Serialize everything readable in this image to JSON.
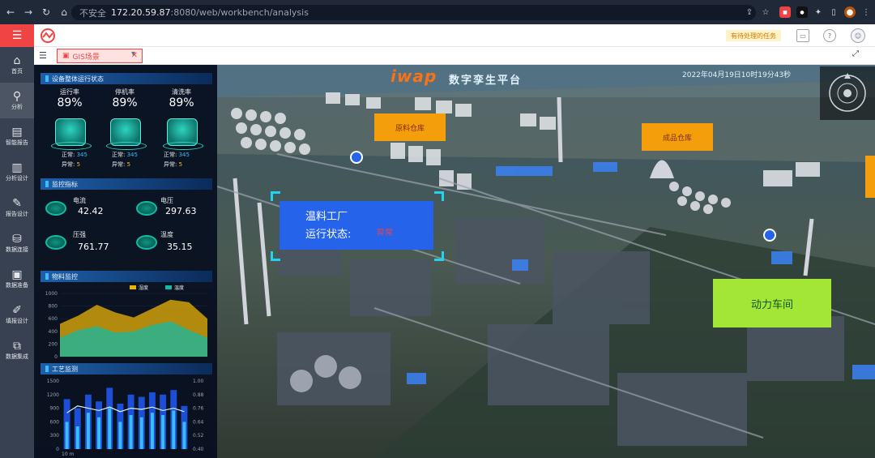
{
  "browser": {
    "security": "不安全",
    "host": "172.20.59.87",
    "path": ":8080/web/workbench/analysis"
  },
  "app": {
    "hint": "有待处理的任务",
    "tabs": [
      {
        "label": "GIS场景"
      }
    ]
  },
  "sidebar": {
    "items": [
      {
        "label": "首页",
        "icon": "home-icon"
      },
      {
        "label": "分析",
        "icon": "analysis-icon"
      },
      {
        "label": "智能报告",
        "icon": "report-icon"
      },
      {
        "label": "分析设计",
        "icon": "design-icon"
      },
      {
        "label": "报告设计",
        "icon": "report-design-icon"
      },
      {
        "label": "数据连接",
        "icon": "data-connect-icon"
      },
      {
        "label": "数据准备",
        "icon": "data-prep-icon"
      },
      {
        "label": "填报设计",
        "icon": "form-icon"
      },
      {
        "label": "数据集成",
        "icon": "integrate-icon"
      }
    ]
  },
  "dashboard": {
    "brand": "iwap",
    "title": "数字孪生平台",
    "datetime": "2022年04月19日10时19分43秒",
    "device_section": "设备整体运行状态",
    "kpis": [
      {
        "label": "运行率",
        "value": "89%",
        "normal": "345",
        "abnormal": "5"
      },
      {
        "label": "停机率",
        "value": "89%",
        "normal": "345",
        "abnormal": "5"
      },
      {
        "label": "清洗率",
        "value": "89%",
        "normal": "345",
        "abnormal": "5"
      }
    ],
    "normal_label": "正常:",
    "abnormal_label": "异常:",
    "monitor_section": "监控指标",
    "monitors": [
      {
        "label": "电流",
        "value": "42.42"
      },
      {
        "label": "电压",
        "value": "297.63"
      },
      {
        "label": "压强",
        "value": "761.77"
      },
      {
        "label": "温度",
        "value": "35.15"
      }
    ],
    "material_section": "物料监控",
    "material_legend": [
      "湿度",
      "温度"
    ],
    "material_yticks": [
      "1000",
      "800",
      "600",
      "400",
      "200",
      "0"
    ],
    "process_section": "工艺监测",
    "process_left_ticks": [
      "1500",
      "1200",
      "900",
      "600",
      "300",
      "0"
    ],
    "process_right_ticks": [
      "1.00",
      "0.88",
      "0.76",
      "0.64",
      "0.52",
      "0.40"
    ],
    "process_xlabel": "10 m"
  },
  "chart_data": [
    {
      "type": "area",
      "ylim": [
        0,
        1000
      ],
      "series": [
        {
          "name": "湿度",
          "values": [
            520,
            650,
            820,
            700,
            620,
            760,
            900,
            860,
            600
          ]
        },
        {
          "name": "温度",
          "values": [
            300,
            420,
            480,
            380,
            400,
            500,
            560,
            420,
            300
          ]
        }
      ]
    },
    {
      "type": "bar",
      "ylim": [
        0,
        1500
      ],
      "y2lim": [
        0.4,
        1.0
      ],
      "series": [
        {
          "values": [
            1100,
            900,
            1200,
            1050,
            1350,
            1000,
            1200,
            1150,
            1250,
            1200,
            1300,
            950
          ]
        },
        {
          "values": [
            600,
            500,
            800,
            700,
            900,
            600,
            750,
            700,
            800,
            750,
            850,
            600
          ]
        },
        {
          "values": [
            0.72,
            0.78,
            0.76,
            0.74,
            0.77,
            0.73,
            0.76,
            0.75,
            0.77,
            0.74,
            0.76,
            0.73
          ]
        }
      ]
    }
  ],
  "scene": {
    "labels": [
      {
        "text": "原料仓库"
      },
      {
        "text": "成品仓库"
      },
      {
        "text": "动力车间"
      }
    ],
    "factory": {
      "name": "温料工厂",
      "status_label": "运行状态:",
      "status": "异常"
    }
  },
  "colors": {
    "accent": "#ef4444",
    "panel": "#0a1628",
    "teal": "#14b8a6"
  }
}
